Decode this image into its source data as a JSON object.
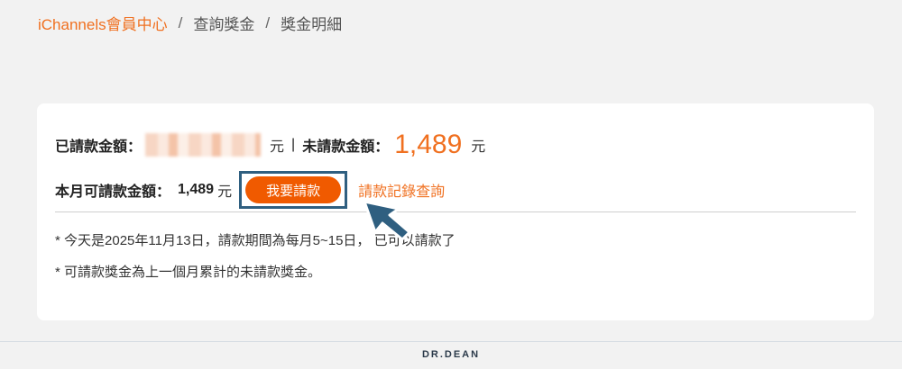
{
  "breadcrumb": {
    "home": "iChannels會員中心",
    "sep": "/",
    "level2": "查詢獎金",
    "level3": "獎金明細"
  },
  "summary": {
    "claimed_label": "已請款金額：",
    "unit": "元",
    "pipe": "|",
    "unclaimed_label": "未請款金額：",
    "unclaimed_amount": "1,489"
  },
  "claimable": {
    "label": "本月可請款金額：",
    "amount": "1,489",
    "unit": "元",
    "apply_button": "我要請款",
    "record_link": "請款記錄查詢"
  },
  "notes": {
    "note1": "* 今天是2025年11月13日，請款期間為每月5~15日， 已可以請款了",
    "note2": "* 可請款獎金為上一個月累計的未請款獎金。"
  },
  "footer": {
    "logo": "DR.DEAN"
  },
  "colors": {
    "accent": "#f07020",
    "button": "#f05a00",
    "highlight_border": "#2f5f80"
  },
  "icons": [
    "pointer-cursor-icon"
  ]
}
